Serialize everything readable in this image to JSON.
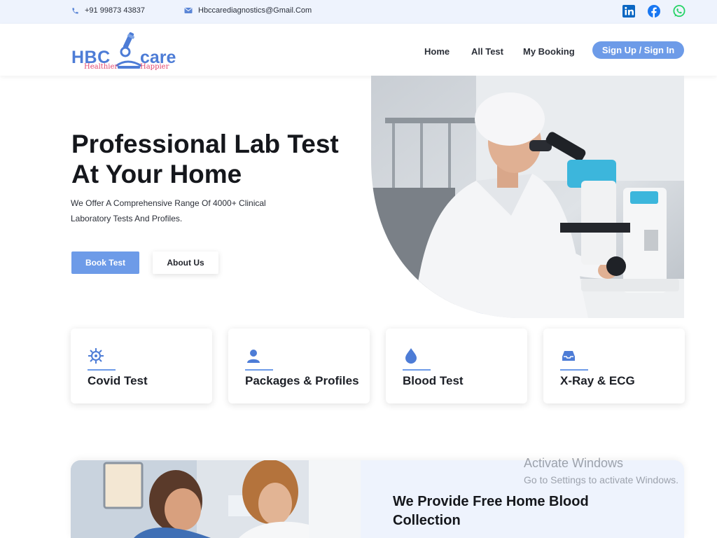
{
  "topbar": {
    "phone": "+91 99873 43837",
    "email": "Hbccarediagnostics@Gmail.Com",
    "social": [
      "linkedin-icon",
      "facebook-icon",
      "whatsapp-icon"
    ]
  },
  "header": {
    "logo": {
      "part1": "HBC",
      "part2": "care",
      "tagline1": "Healthier",
      "tagline2": "Happier"
    },
    "nav": [
      "Home",
      "All Test",
      "My Booking"
    ],
    "signin_label": "Sign Up / Sign In"
  },
  "hero": {
    "title_line1": "Professional Lab Test",
    "title_line2": "At Your Home",
    "subtitle_line1": "We Offer A Comprehensive Range Of 4000+ Clinical",
    "subtitle_line2": "Laboratory Tests And Profiles.",
    "book_label": "Book Test",
    "about_label": "About Us"
  },
  "services": [
    {
      "label": "Covid Test",
      "icon": "virus-icon"
    },
    {
      "label": "Packages & Profiles",
      "icon": "user-icon"
    },
    {
      "label": "Blood Test",
      "icon": "blood-drop-icon"
    },
    {
      "label": "X-Ray & ECG",
      "icon": "tray-icon"
    }
  ],
  "bottom": {
    "title_line1": "We Provide Free Home Blood",
    "title_line2": "Collection"
  },
  "watermark": {
    "line1": "Activate Windows",
    "line2": "Go to Settings to activate Windows."
  },
  "colors": {
    "accent": "#6d9be8",
    "topbar_bg": "#eef3fd",
    "logo_blue": "#4d7cd6",
    "logo_pink": "#e2466e"
  }
}
